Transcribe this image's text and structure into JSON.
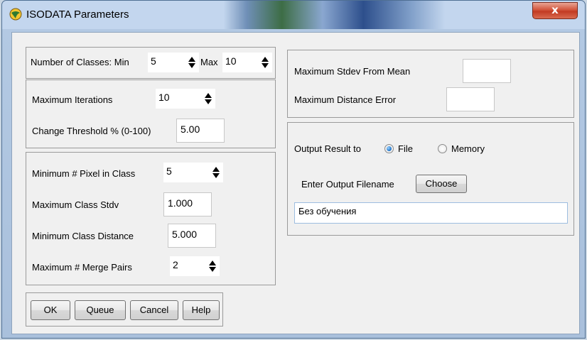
{
  "window": {
    "title": "ISODATA Parameters",
    "close_glyph": "x",
    "title_icon": "globe-icon"
  },
  "classes": {
    "label_min": "Number of Classes: Min",
    "min_value": "5",
    "label_max": "Max",
    "max_value": "10"
  },
  "iterations": {
    "max_iterations_label": "Maximum Iterations",
    "max_iterations_value": "10",
    "threshold_label": "Change Threshold % (0-100)",
    "threshold_value": "5.00"
  },
  "pixels": {
    "min_pixel_label": "Minimum # Pixel in Class",
    "min_pixel_value": "5",
    "max_stdv_label": "Maximum Class Stdv",
    "max_stdv_value": "1.000",
    "min_distance_label": "Minimum Class Distance",
    "min_distance_value": "5.000",
    "merge_pairs_label": "Maximum # Merge Pairs",
    "merge_pairs_value": "2"
  },
  "stdev": {
    "max_stdev_label": "Maximum Stdev From Mean",
    "max_stdev_value": "",
    "max_distance_error_label": "Maximum Distance Error",
    "max_distance_error_value": ""
  },
  "output": {
    "result_label": "Output Result to",
    "file_label": "File",
    "memory_label": "Memory",
    "selected": "File",
    "filename_label": "Enter Output Filename",
    "choose_label": "Choose",
    "filename_value": "Без обучения"
  },
  "buttons": {
    "ok": "OK",
    "queue": "Queue",
    "cancel": "Cancel",
    "help": "Help"
  },
  "colors": {
    "radio_accent": "#2b7fd1",
    "close_red": "#c23a22"
  }
}
